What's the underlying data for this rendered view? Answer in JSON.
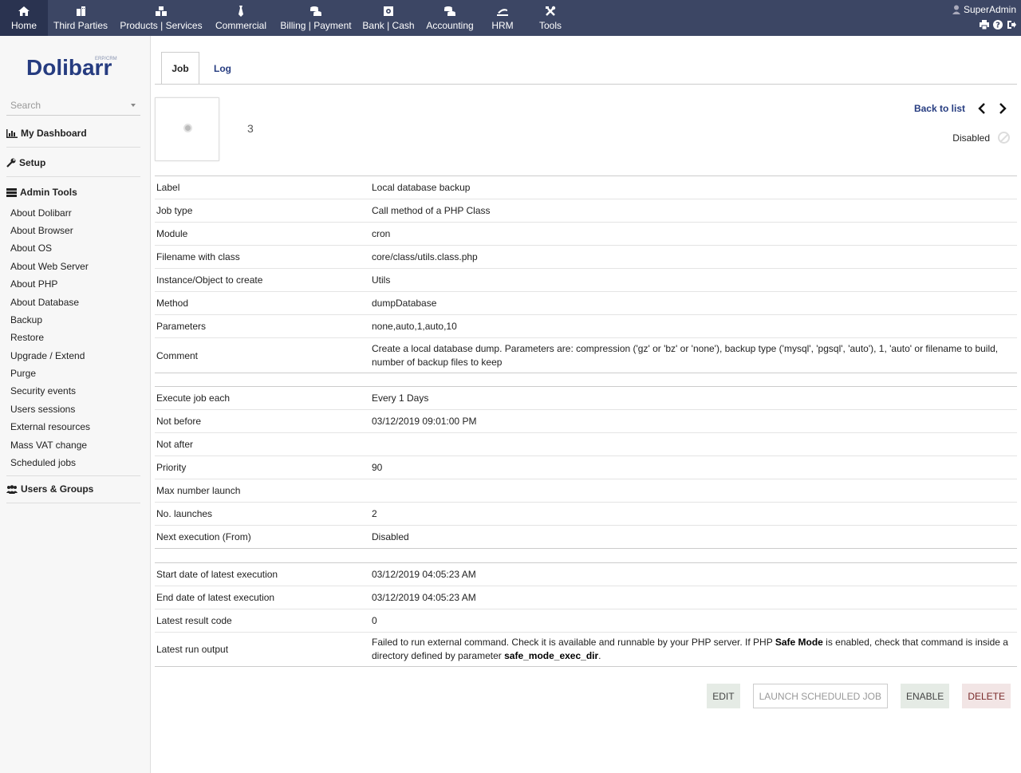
{
  "topbar": {
    "menu": [
      {
        "label": "Home",
        "icon": "home-icon"
      },
      {
        "label": "Third Parties",
        "icon": "building-icon"
      },
      {
        "label": "Products | Services",
        "icon": "boxes-icon"
      },
      {
        "label": "Commercial",
        "icon": "tie-icon"
      },
      {
        "label": "Billing | Payment",
        "icon": "coins-icon"
      },
      {
        "label": "Bank | Cash",
        "icon": "safe-icon"
      },
      {
        "label": "Accounting",
        "icon": "coins-icon"
      },
      {
        "label": "HRM",
        "icon": "hrm-icon"
      },
      {
        "label": "Tools",
        "icon": "tools-icon"
      }
    ],
    "user": "SuperAdmin"
  },
  "sidebar": {
    "logo_text": "Dolibarr",
    "logo_sub": "ERP/CRM",
    "search_placeholder": "Search",
    "dashboard": "My Dashboard",
    "setup": "Setup",
    "admin_tools": "Admin Tools",
    "admin_items": [
      "About Dolibarr",
      "About Browser",
      "About OS",
      "About Web Server",
      "About PHP",
      "About Database",
      "Backup",
      "Restore",
      "Upgrade / Extend",
      "Purge",
      "Security events",
      "Users sessions",
      "External resources",
      "Mass VAT change",
      "Scheduled jobs"
    ],
    "users_groups": "Users & Groups"
  },
  "tabs": [
    "Job",
    "Log"
  ],
  "record": {
    "ref": "3",
    "back_to_list": "Back to list",
    "status": "Disabled"
  },
  "fields1": [
    {
      "label": "Label",
      "value": "Local database backup"
    },
    {
      "label": "Job type",
      "value": "Call method of a PHP Class"
    },
    {
      "label": "Module",
      "value": "cron"
    },
    {
      "label": "Filename with class",
      "value": "core/class/utils.class.php"
    },
    {
      "label": "Instance/Object to create",
      "value": "Utils"
    },
    {
      "label": "Method",
      "value": "dumpDatabase"
    },
    {
      "label": "Parameters",
      "value": "none,auto,1,auto,10"
    },
    {
      "label": "Comment",
      "value": "Create a local database dump. Parameters are: compression ('gz' or 'bz' or 'none'), backup type ('mysql', 'pgsql', 'auto'), 1, 'auto' or filename to build, number of backup files to keep"
    }
  ],
  "fields2": [
    {
      "label": "Execute job each",
      "value": "Every 1 Days"
    },
    {
      "label": "Not before",
      "value": "03/12/2019 09:01:00 PM"
    },
    {
      "label": "Not after",
      "value": ""
    },
    {
      "label": "Priority",
      "value": "90"
    },
    {
      "label": "Max number launch",
      "value": ""
    },
    {
      "label": "No. launches",
      "value": "2"
    },
    {
      "label": "Next execution (From)",
      "value": "Disabled"
    }
  ],
  "fields3": [
    {
      "label": "Start date of latest execution",
      "value": "03/12/2019 04:05:23 AM"
    },
    {
      "label": "End date of latest execution",
      "value": "03/12/2019 04:05:23 AM"
    },
    {
      "label": "Latest result code",
      "value": "0"
    },
    {
      "label": "Latest run output",
      "value_parts": [
        "Failed to run external command. Check it is available and runnable by your PHP server. If PHP ",
        "Safe Mode",
        " is enabled, check that command is inside a directory defined by parameter ",
        "safe_mode_exec_dir",
        "."
      ]
    }
  ],
  "buttons": {
    "edit": "Edit",
    "launch": "Launch scheduled job",
    "enable": "Enable",
    "delete": "Delete"
  },
  "colors": {
    "topbar": "#3c4664",
    "link": "#263c80"
  }
}
